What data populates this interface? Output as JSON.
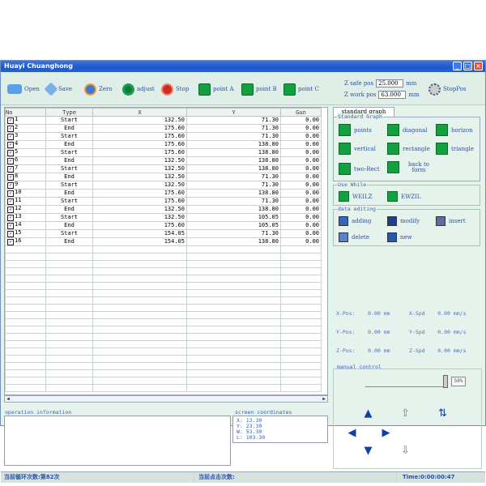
{
  "window": {
    "title": "Huayi Chuanghong"
  },
  "toolbar": {
    "open": "Open",
    "save": "Save",
    "zero": "Zero",
    "adjust": "adjust",
    "stop": "Stop",
    "point_a": "point A",
    "point_b": "point B",
    "point_c": "point C",
    "z_safe_label": "Z safe pos",
    "z_safe_value": "25.000",
    "z_safe_unit": "mm",
    "z_work_label": "Z work pos",
    "z_work_value": "63.000",
    "z_work_unit": "mm",
    "stoppos": "StopPos"
  },
  "table": {
    "headers": [
      "No",
      "Type",
      "X",
      "Y",
      "Gun"
    ],
    "rows": [
      [
        "1",
        "Start",
        "132.50",
        "71.30",
        "0.00"
      ],
      [
        "2",
        "End",
        "175.60",
        "71.30",
        "0.00"
      ],
      [
        "3",
        "Start",
        "175.60",
        "71.30",
        "0.00"
      ],
      [
        "4",
        "End",
        "175.60",
        "138.80",
        "0.00"
      ],
      [
        "5",
        "Start",
        "175.60",
        "138.80",
        "0.00"
      ],
      [
        "6",
        "End",
        "132.50",
        "138.80",
        "0.00"
      ],
      [
        "7",
        "Start",
        "132.50",
        "138.80",
        "0.00"
      ],
      [
        "8",
        "End",
        "132.50",
        "71.30",
        "0.00"
      ],
      [
        "9",
        "Start",
        "132.50",
        "71.30",
        "0.00"
      ],
      [
        "10",
        "End",
        "175.60",
        "138.80",
        "0.00"
      ],
      [
        "11",
        "Start",
        "175.60",
        "71.30",
        "0.00"
      ],
      [
        "12",
        "End",
        "132.50",
        "138.80",
        "0.00"
      ],
      [
        "13",
        "Start",
        "132.50",
        "105.05",
        "0.00"
      ],
      [
        "14",
        "End",
        "175.60",
        "105.05",
        "0.00"
      ],
      [
        "15",
        "Start",
        "154.05",
        "71.30",
        "0.00"
      ],
      [
        "16",
        "End",
        "154.05",
        "138.80",
        "0.00"
      ]
    ]
  },
  "right": {
    "tab": "standard graph",
    "std_group": "Standard Graph",
    "points": "points",
    "diagonal": "diagonal",
    "horizon": "horizon",
    "vertical": "vertical",
    "rectangle": "rectangle",
    "triangle": "triangle",
    "two_rect": "two-Rect",
    "back_to_form": "back to form",
    "use_group": "Use While",
    "weilz": "WEILZ",
    "ewzil": "EWZIL",
    "edit_group": "data editing",
    "adding": "adding",
    "modify": "modify",
    "insert": "insert",
    "delete": "delete",
    "new": "new"
  },
  "readout": {
    "x_pos": "X-Pos:",
    "x_pos_val": "0.00 mm",
    "x_spd": "X-Spd",
    "x_spd_val": "0.00 mm/s",
    "y_pos": "Y-Pos:",
    "y_pos_val": "0.00 mm",
    "y_spd": "Y-Spd",
    "y_spd_val": "0.00 mm/s",
    "z_pos": "Z-Pos:",
    "z_pos_val": "0.00 mm",
    "z_spd": "Z-Spd",
    "z_spd_val": "0.00 mm/s"
  },
  "manual": {
    "label": "manual control",
    "percent": "50%"
  },
  "operation": {
    "label": "operation information"
  },
  "coords": {
    "label": "screen coordinates",
    "x": "X: 13.30",
    "y": "Y: 23.30",
    "w": "W: 53.30",
    "l": "L: 103.30"
  },
  "status": {
    "cycles": "当前循环次数:第82次",
    "clicks": "当前点击次数:",
    "time": "Time:0:00:00:47"
  },
  "colors": {
    "accent": "#12a040",
    "title": "#1f57c8"
  }
}
